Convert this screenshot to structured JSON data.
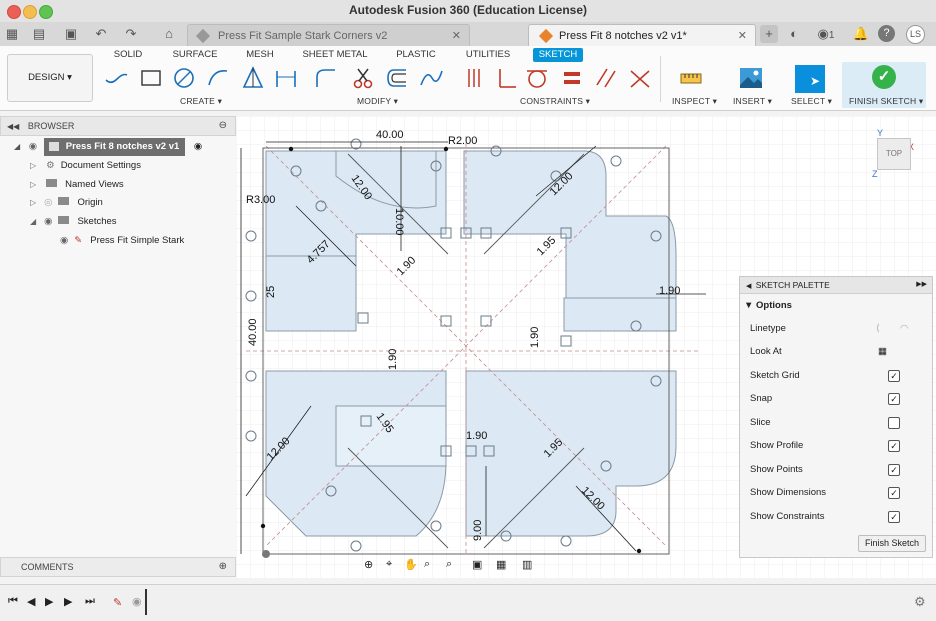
{
  "window": {
    "title": "Autodesk Fusion 360 (Education License)"
  },
  "tabs": [
    {
      "label": "Press Fit Sample Stark Corners v2",
      "active": false
    },
    {
      "label": "Press Fit 8 notches v2 v1*",
      "active": true
    }
  ],
  "header_right": {
    "job_count": "1",
    "user_initials": "LS"
  },
  "ribbon": {
    "workspace": "DESIGN",
    "tabs": [
      "SOLID",
      "SURFACE",
      "MESH",
      "SHEET METAL",
      "PLASTIC",
      "UTILITIES",
      "SKETCH"
    ],
    "active_tab": "SKETCH",
    "groups": [
      "CREATE",
      "MODIFY",
      "CONSTRAINTS",
      "INSPECT",
      "INSERT",
      "SELECT",
      "FINISH SKETCH"
    ]
  },
  "browser": {
    "title": "BROWSER",
    "root": "Press Fit 8 notches v2 v1",
    "items": [
      "Document Settings",
      "Named Views",
      "Origin",
      "Sketches"
    ],
    "sketch": "Press Fit Simple Stark"
  },
  "comments": {
    "title": "COMMENTS"
  },
  "viewcube": {
    "face": "TOP",
    "axis_y": "Y",
    "axis_x": "X",
    "axis_z": "Z"
  },
  "dimensions": [
    "40.00",
    "R2.00",
    "12.00",
    "10.00",
    "12.00",
    "R3.00",
    "4.757",
    "1.95",
    "1.90",
    "25",
    "1.90",
    "40.00",
    "1.90",
    "1.90",
    "12.00",
    "1.95",
    "1.90",
    "1.95",
    "12.00",
    "9.00"
  ],
  "sketch_palette": {
    "title": "SKETCH PALETTE",
    "section": "Options",
    "rows": [
      {
        "label": "Linetype",
        "checked": null
      },
      {
        "label": "Look At",
        "checked": null
      },
      {
        "label": "Sketch Grid",
        "checked": true
      },
      {
        "label": "Snap",
        "checked": true
      },
      {
        "label": "Slice",
        "checked": false
      },
      {
        "label": "Show Profile",
        "checked": true
      },
      {
        "label": "Show Points",
        "checked": true
      },
      {
        "label": "Show Dimensions",
        "checked": true
      },
      {
        "label": "Show Constraints",
        "checked": true
      }
    ],
    "finish_button": "Finish Sketch"
  },
  "colors": {
    "accent": "#0696d7",
    "finish_green": "#36b24b",
    "profile_fill": "#dbe9f4",
    "sketch_line": "#6b7b8a"
  }
}
